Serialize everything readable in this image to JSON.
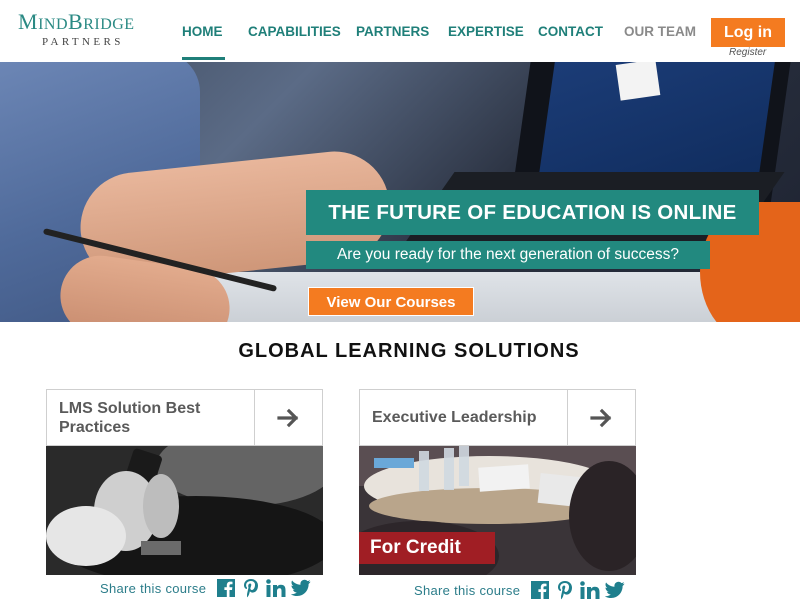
{
  "logo": {
    "main_big1": "M",
    "main_rest1": "IND",
    "main_big2": "B",
    "main_rest2": "RIDGE",
    "sub": "PARTNERS"
  },
  "nav": {
    "items": [
      {
        "label": "HOME",
        "active": true
      },
      {
        "label": "CAPABILITIES"
      },
      {
        "label": "PARTNERS"
      },
      {
        "label": "EXPERTISE"
      },
      {
        "label": "CONTACT"
      },
      {
        "label": "OUR TEAM"
      }
    ],
    "login_label": "Log in",
    "register_label": "Register"
  },
  "hero": {
    "title": "THE FUTURE OF EDUCATION IS ONLINE",
    "subtitle": "Are you ready for the next generation of success?",
    "button_label": "View Our Courses"
  },
  "section": {
    "title": "GLOBAL LEARNING SOLUTIONS"
  },
  "courses": [
    {
      "title": "LMS Solution Best Practices",
      "share_label": "Share this course"
    },
    {
      "title": "Executive Leadership",
      "share_label": "Share this course",
      "tag": "For Credit"
    }
  ],
  "colors": {
    "teal": "#22897f",
    "orange": "#f47b20",
    "credit_red": "#a01e24",
    "nav_teal": "#1f7f79",
    "share_teal": "#2c7d8a"
  },
  "icons": [
    "arrow-right-icon",
    "facebook-icon",
    "pinterest-icon",
    "linkedin-icon",
    "twitter-icon"
  ]
}
